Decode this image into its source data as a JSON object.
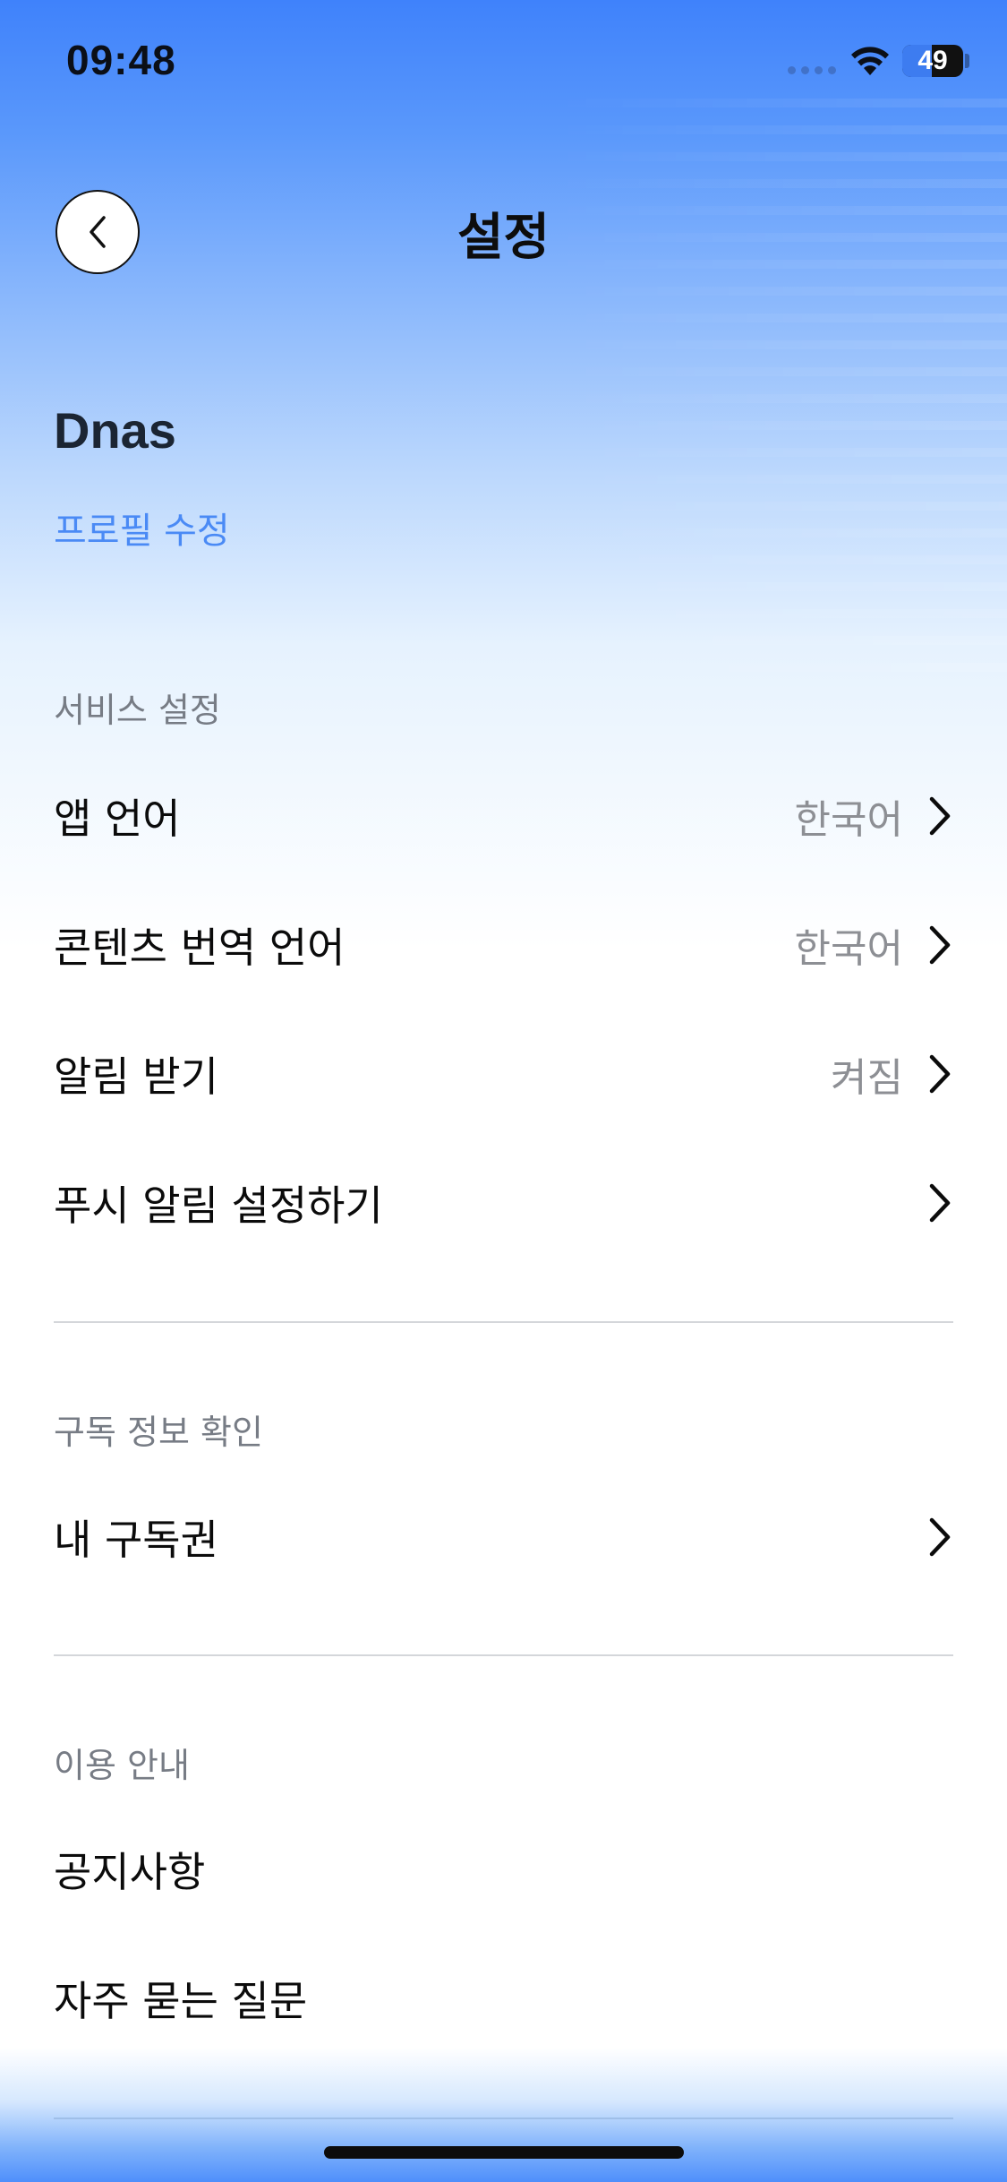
{
  "status_bar": {
    "time": "09:48",
    "battery_level": "49",
    "battery_fraction": 0.49,
    "icons": [
      "signal-dots-icon",
      "wifi-icon",
      "battery-icon"
    ]
  },
  "header": {
    "title": "설정",
    "back_icon": "chevron-left-icon"
  },
  "profile": {
    "name": "Dnas",
    "edit_label": "프로필 수정"
  },
  "sections": {
    "service": {
      "label": "서비스 설정",
      "items": [
        {
          "label": "앱 언어",
          "value": "한국어"
        },
        {
          "label": "콘텐츠 번역 언어",
          "value": "한국어"
        },
        {
          "label": "알림 받기",
          "value": "켜짐"
        },
        {
          "label": "푸시 알림 설정하기",
          "value": ""
        }
      ]
    },
    "subscription": {
      "label": "구독 정보 확인",
      "items": [
        {
          "label": "내 구독권",
          "value": ""
        }
      ]
    },
    "guide": {
      "label": "이용 안내",
      "items": [
        {
          "label": "공지사항"
        },
        {
          "label": "자주 묻는 질문"
        }
      ]
    }
  },
  "colors": {
    "accent": "#4a8af5",
    "gradient_top": "#3f82fb",
    "text_primary": "#0b0b0b",
    "text_secondary": "#8d8f94",
    "section_label": "#777c85"
  }
}
